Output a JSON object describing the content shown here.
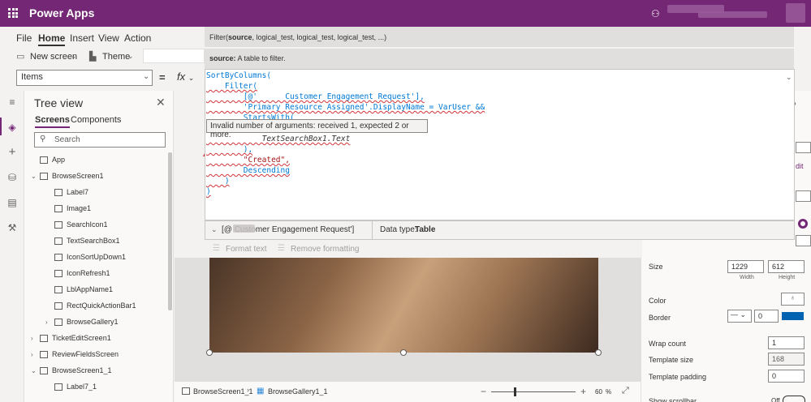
{
  "app": {
    "title": "Power Apps"
  },
  "menu": {
    "items": [
      "File",
      "Home",
      "Insert",
      "View",
      "Action"
    ],
    "active": "Home"
  },
  "toolbar": {
    "new_screen": "New screen",
    "theme": "Theme"
  },
  "formula_bar": {
    "property": "Items",
    "equals": "=",
    "fx": "fx",
    "signature_fn": "Filter(",
    "signature_arg": "source",
    "signature_rest": ", logical_test, logical_test, logical_test, ...)",
    "desc_arg": "source:",
    "desc_text": "A table to filter.",
    "code": [
      "SortByColumns(",
      "    Filter(",
      "        [@'      Customer Engagement Request'],",
      "        'Primary Resource Assigned'.DisplayName = VarUser &&",
      "        StartsWith(",
      "",
      "            TextSearchBox1.Text",
      "        ),",
      "        \"Created\",",
      "        Descending",
      "    )",
      ")"
    ],
    "error_tip": "Invalid number of arguments: received 1, expected 2 or more.",
    "result_label": "[@        Customer Engagement Request']",
    "data_type_label": "Data type:",
    "data_type_value": "Table",
    "format_text": "Format text",
    "remove_formatting": "Remove formatting"
  },
  "tree": {
    "title": "Tree view",
    "tabs": [
      "Screens",
      "Components"
    ],
    "search_placeholder": "Search",
    "items": [
      {
        "label": "App",
        "level": 0,
        "chev": ""
      },
      {
        "label": "BrowseScreen1",
        "level": 0,
        "chev": "v"
      },
      {
        "label": "Label7",
        "level": 1,
        "chev": ""
      },
      {
        "label": "Image1",
        "level": 1,
        "chev": ""
      },
      {
        "label": "SearchIcon1",
        "level": 1,
        "chev": ""
      },
      {
        "label": "TextSearchBox1",
        "level": 1,
        "chev": ""
      },
      {
        "label": "IconSortUpDown1",
        "level": 1,
        "chev": ""
      },
      {
        "label": "IconRefresh1",
        "level": 1,
        "chev": ""
      },
      {
        "label": "LblAppName1",
        "level": 1,
        "chev": ""
      },
      {
        "label": "RectQuickActionBar1",
        "level": 1,
        "chev": ""
      },
      {
        "label": "BrowseGallery1",
        "level": 1,
        "chev": ">"
      },
      {
        "label": "TicketEditScreen1",
        "level": 0,
        "chev": ">"
      },
      {
        "label": "ReviewFieldsScreen",
        "level": 0,
        "chev": ">"
      },
      {
        "label": "BrowseScreen1_1",
        "level": 0,
        "chev": "v"
      },
      {
        "label": "Label7_1",
        "level": 1,
        "chev": ""
      }
    ]
  },
  "bottom": {
    "screen": "BrowseScreen1_1",
    "gallery": "BrowseGallery1_1",
    "zoom": "60",
    "zoom_unit": "%"
  },
  "props": {
    "size_label": "Size",
    "width": "1229",
    "height": "612",
    "width_label": "Width",
    "height_label": "Height",
    "color_label": "Color",
    "border_label": "Border",
    "border_value": "0",
    "wrap_count_label": "Wrap count",
    "wrap_count": "1",
    "template_size_label": "Template size",
    "template_size": "168",
    "template_padding_label": "Template padding",
    "template_padding": "0",
    "show_scrollbar_label": "Show scrollbar",
    "show_scrollbar": "Off",
    "border_color": "#0063b1"
  },
  "colors": {
    "brand": "#742774",
    "error": "#d13438"
  }
}
